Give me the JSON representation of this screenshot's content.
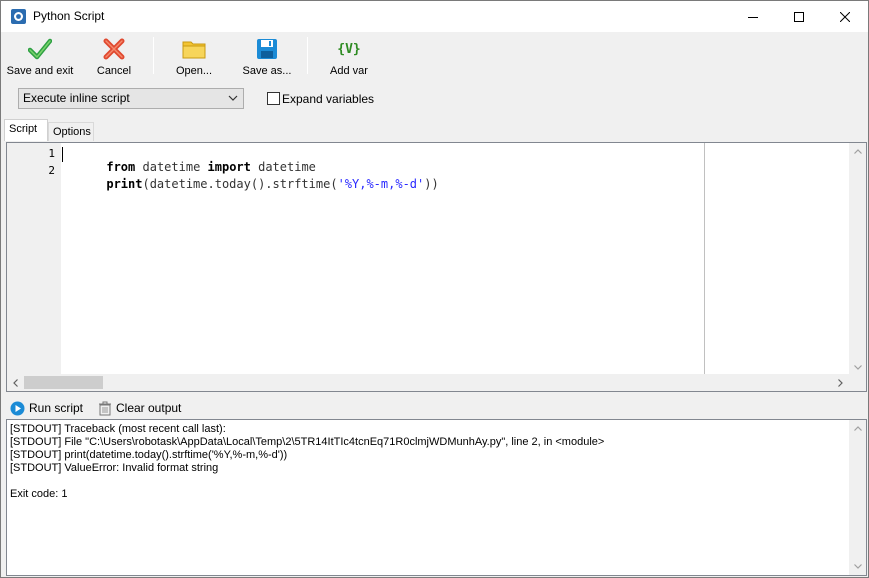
{
  "window": {
    "title": "Python Script"
  },
  "toolbar": {
    "save_exit": "Save and exit",
    "cancel": "Cancel",
    "open": "Open...",
    "save_as": "Save as...",
    "add_var": "Add var",
    "add_var_glyph": "{V}"
  },
  "options": {
    "mode_selected": "Execute inline script",
    "expand_variables": "Expand variables",
    "expand_checked": false
  },
  "tabs": {
    "script": "Script",
    "options": "Options",
    "active": "Script"
  },
  "editor": {
    "lines": [
      {
        "num": "1",
        "tokens": [
          {
            "t": "from",
            "k": "kw"
          },
          {
            "t": " datetime ",
            "k": "id"
          },
          {
            "t": "import",
            "k": "kw"
          },
          {
            "t": " datetime",
            "k": "id"
          }
        ]
      },
      {
        "num": "2",
        "tokens": [
          {
            "t": "print",
            "k": "kw"
          },
          {
            "t": "(datetime.today().strftime(",
            "k": "id"
          },
          {
            "t": "'%Y,%-m,%-d'",
            "k": "str"
          },
          {
            "t": "))",
            "k": "id"
          }
        ]
      }
    ]
  },
  "run": {
    "run_label": "Run script",
    "clear_label": "Clear output"
  },
  "output": {
    "lines": [
      "[STDOUT] Traceback (most recent call last):",
      "[STDOUT] File \"C:\\Users\\robotask\\AppData\\Local\\Temp\\2\\5TR14ItTIc4tcnEq71R0clmjWDMunhAy.py\", line 2, in <module>",
      "[STDOUT] print(datetime.today().strftime('%Y,%-m,%-d'))",
      "[STDOUT] ValueError: Invalid format string",
      "",
      "Exit code: 1"
    ]
  },
  "colors": {
    "accent_green": "#2ea043",
    "cancel_red": "#e0492f",
    "folder_yellow": "#f3c432",
    "save_blue": "#1b8bd6",
    "keyword": "#000000",
    "string": "#2a2aff"
  }
}
